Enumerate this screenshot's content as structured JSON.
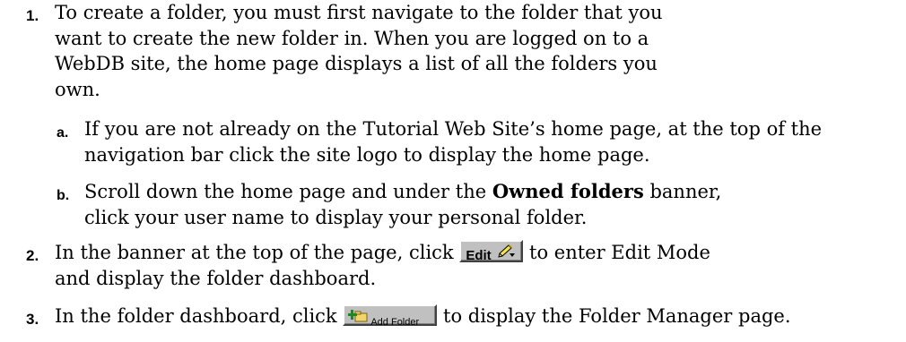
{
  "steps": [
    {
      "number": "1.",
      "text": "To create a folder, you must first navigate to the folder that you want to create the new folder in. When you are logged on to a WebDB site, the home page displays a list of all the folders you own.",
      "substeps": [
        {
          "letter": "a.",
          "text": "If you are not already on the Tutorial Web Site’s home page, at the top of the navigation bar click the site logo to display the home page."
        },
        {
          "letter": "b.",
          "text_before": "Scroll down the home page and under the ",
          "bold": "Owned folders",
          "text_after": " banner, click your user name to display your personal folder."
        }
      ]
    },
    {
      "number": "2.",
      "text_before": "In the banner at the top of the page, click ",
      "button_label": "Edit",
      "button_icon": "pencil-icon",
      "text_after": " to enter Edit Mode and display the folder dashboard."
    },
    {
      "number": "3.",
      "text_before": "In the folder dashboard, click ",
      "button_label": "Add Folder",
      "button_icon": "add-folder-icon",
      "text_after": " to display the Folder Manager page."
    }
  ]
}
